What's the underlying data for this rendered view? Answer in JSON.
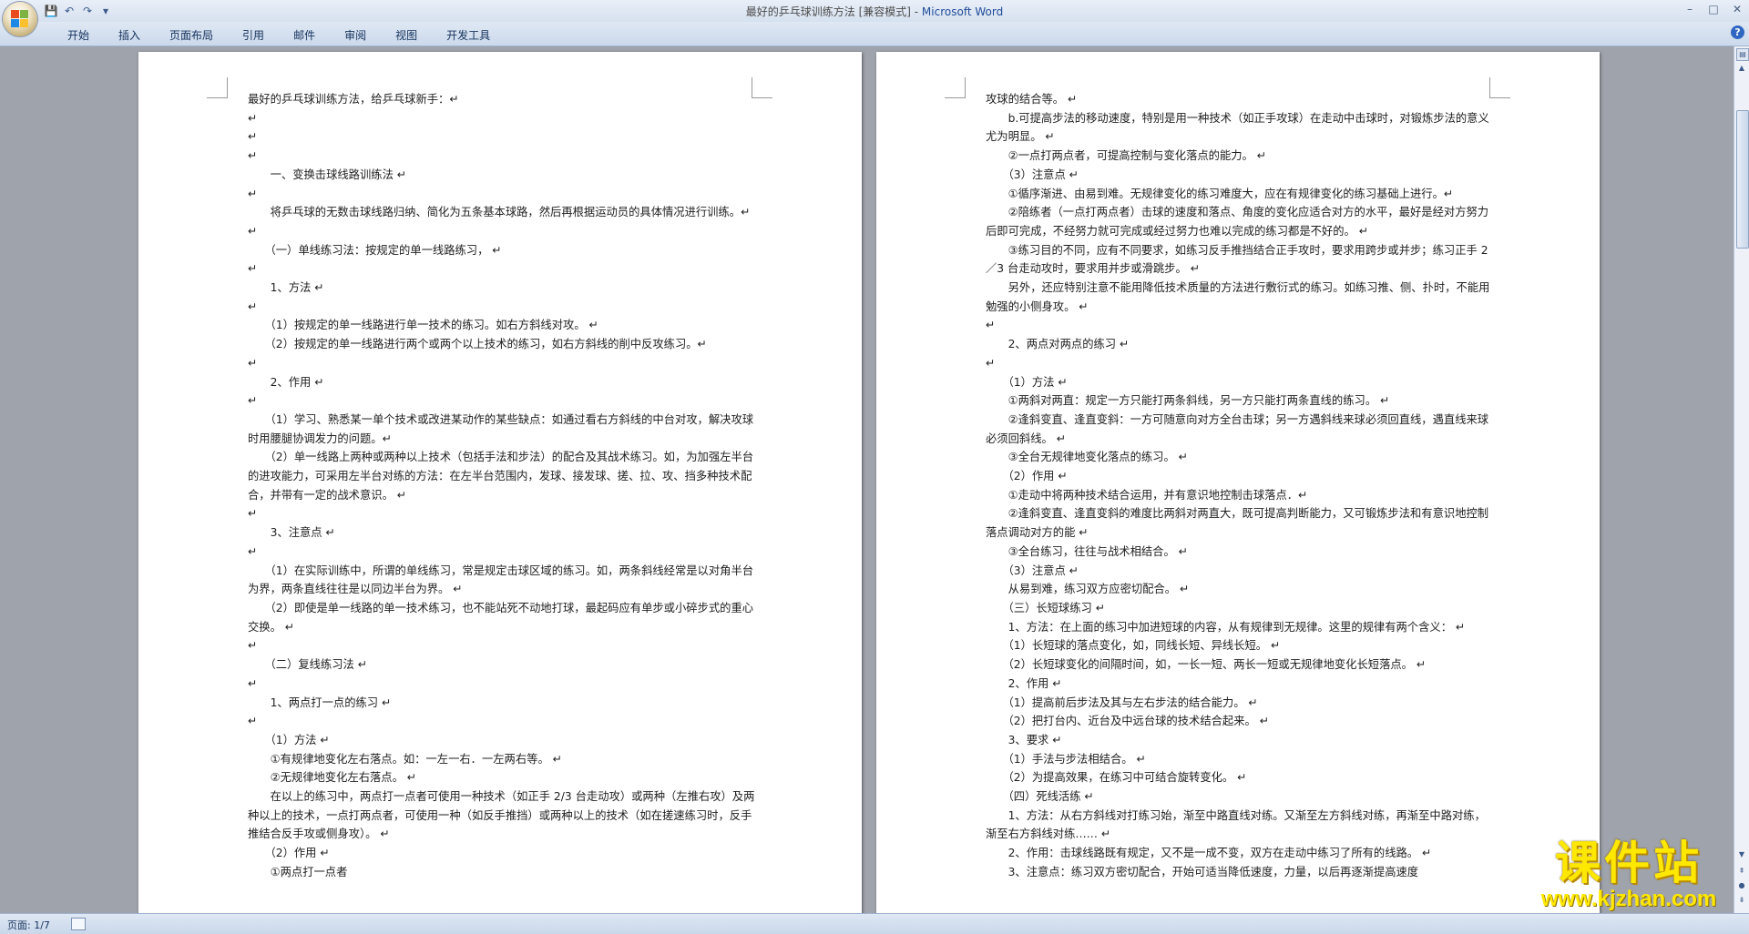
{
  "window": {
    "title_doc": "最好的乒乓球训练方法 [兼容模式] - ",
    "title_app": "Microsoft Word",
    "minimize": "–",
    "maximize": "□",
    "close": "✕"
  },
  "qat": {
    "save": "💾",
    "undo": "↶",
    "redo": "↷",
    "customize": "▾"
  },
  "tabs": [
    "开始",
    "插入",
    "页面布局",
    "引用",
    "邮件",
    "审阅",
    "视图",
    "开发工具"
  ],
  "help": "?",
  "colors": {
    "office_logo": [
      "#e84c1e",
      "#7cb342",
      "#1e88e5",
      "#fbc02d"
    ]
  },
  "pages": [
    {
      "paragraphs": [
        "最好的乒乓球训练方法，给乒乓球新手：↵",
        "↵",
        "↵",
        "↵",
        "　　一、变换击球线路训练法 ↵",
        "↵",
        "　　将乒乓球的无数击球线路归纳、简化为五条基本球路，然后再根据运动员的具体情况进行训练。↵",
        "↵",
        "　　（一）单线练习法：按规定的单一线路练习， ↵",
        "↵",
        "　　1、方法 ↵",
        "↵",
        "　　（1）按规定的单一线路进行单一技术的练习。如右方斜线对攻。 ↵",
        "　　（2）按规定的单一线路进行两个或两个以上技术的练习，如右方斜线的削中反攻练习。↵",
        "↵",
        "　　2、作用 ↵",
        "↵",
        "　　（1）学习、熟悉某一单个技术或改进某动作的某些缺点：如通过看右方斜线的中台对攻，解决攻球时用腰腿协调发力的问题。↵",
        "　　（2）单一线路上两种或两种以上技术（包括手法和步法）的配合及其战术练习。如，为加强左半台的进攻能力，可采用左半台对练的方法：在左半台范围内，发球、接发球、搓、拉、攻、挡多种技术配合，并带有一定的战术意识。 ↵",
        "↵",
        "　　3、注意点 ↵",
        "↵",
        "　　（1）在实际训练中，所谓的单线练习，常是规定击球区域的练习。如，两条斜线经常是以对角半台为界，两条直线往往是以同边半台为界。 ↵",
        "　　（2）即使是单一线路的单一技术练习，也不能站死不动地打球，最起码应有单步或小碎步式的重心交换。 ↵",
        "↵",
        "　　（二）复线练习法 ↵",
        "↵",
        "　　1、两点打一点的练习 ↵",
        "↵",
        "　　（1）方法 ↵",
        "　　①有规律地变化左右落点。如：一左一右．一左两右等。 ↵",
        "　　②无规律地变化左右落点。 ↵",
        "　　在以上的练习中，两点打一点者可使用一种技术（如正手 2/3 台走动攻）或两种（左推右攻）及两种以上的技术，一点打两点者，可使用一种（如反手推挡）或两种以上的技术（如在搓速练习时，反手推结合反手攻或侧身攻）。 ↵",
        "　　（2）作用 ↵",
        "　　①两点打一点者"
      ]
    },
    {
      "paragraphs": [
        "攻球的结合等。 ↵",
        "　　b.可提高步法的移动速度，特别是用一种技术（如正手攻球）在走动中击球时，对锻炼步法的意义尤为明显。 ↵",
        "　　②一点打两点者，可提高控制与变化落点的能力。 ↵",
        "　　（3）注意点 ↵",
        "　　①循序渐进、由易到难。无规律变化的练习难度大，应在有规律变化的练习基础上进行。↵",
        "　　②陪练者（一点打两点者）击球的速度和落点、角度的变化应适合对方的水平，最好是经对方努力后即可完成，不经努力就可完成或经过努力也难以完成的练习都是不好的。 ↵",
        "　　③练习目的不同，应有不同要求，如练习反手推挡结合正手攻时，要求用跨步或并步；练习正手 2／3 台走动攻时，要求用并步或滑跳步。 ↵",
        "　　另外，还应特别注意不能用降低技术质量的方法进行敷衍式的练习。如练习推、侧、扑时，不能用勉强的小侧身攻。 ↵",
        "↵",
        "　　2、两点对两点的练习 ↵",
        "↵",
        "　　（1）方法 ↵",
        "　　①两斜对两直：规定一方只能打两条斜线，另一方只能打两条直线的练习。 ↵",
        "　　②逢斜变直、逢直变斜：一方可随意向对方全台击球；另一方遇斜线来球必须回直线，遇直线来球必须回斜线。 ↵",
        "　　③全台无规律地变化落点的练习。 ↵",
        "　　（2）作用 ↵",
        "　　①走动中将两种技术结合运用，并有意识地控制击球落点．↵",
        "　　②逢斜变直、逢直变斜的难度比两斜对两直大，既可提高判断能力，又可锻炼步法和有意识地控制落点调动对方的能 ↵",
        "　　③全台练习，往往与战术相结合。 ↵",
        "　　（3）注意点 ↵",
        "　　从易到难，练习双方应密切配合。 ↵",
        "　　（三）长短球练习 ↵",
        "　　1、方法：在上面的练习中加进短球的内容，从有规律到无规律。这里的规律有两个含义： ↵",
        "　　（1）长短球的落点变化，如，同线长短、异线长短。 ↵",
        "　　（2）长短球变化的间隔时间，如，一长一短、两长一短或无规律地变化长短落点。 ↵",
        "　　2、作用 ↵",
        "　　（1）提高前后步法及其与左右步法的结合能力。 ↵",
        "　　（2）把打台内、近台及中远台球的技术结合起来。 ↵",
        "　　3、要求 ↵",
        "　　（1）手法与步法相结合。 ↵",
        "　　（2）为提高效果，在练习中可结合旋转变化。 ↵",
        "　　（四）死线活练 ↵",
        "　　1、方法：从右方斜线对打练习始，渐至中路直线对练。又渐至左方斜线对练，再渐至中路对练，渐至右方斜线对练…… ↵",
        "　　2、作用：击球线路既有规定，又不是一成不变，双方在走动中练习了所有的线路。 ↵",
        "　　3、注意点：练习双方密切配合，开始可适当降低速度，力量，以后再逐渐提高速度"
      ]
    }
  ],
  "status": {
    "page": "页面: 1/7"
  },
  "watermark": {
    "cn": "课件站",
    "url": "www.kjzhan.com"
  }
}
